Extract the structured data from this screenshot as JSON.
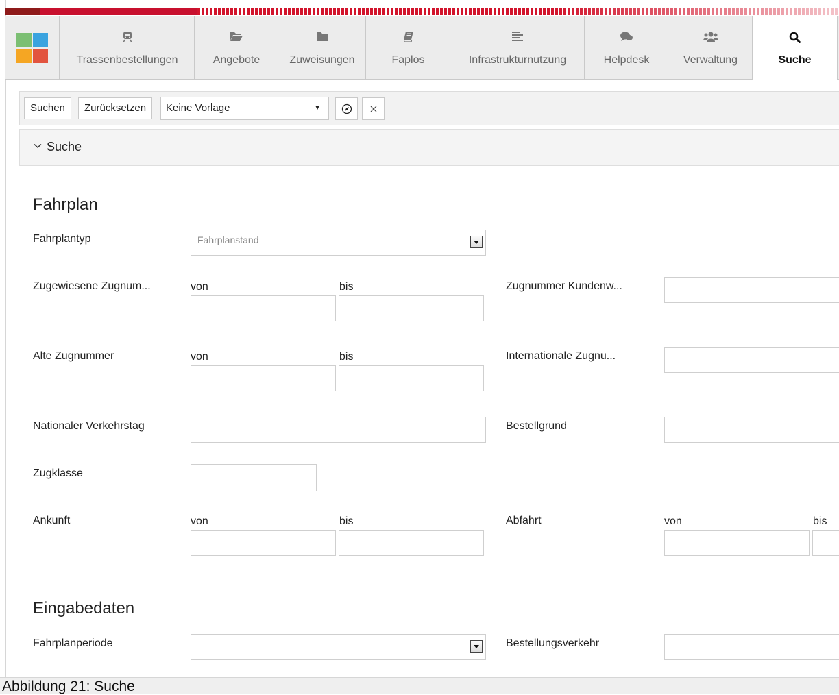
{
  "nav": {
    "tabs": [
      {
        "label": "Trassenbestellungen",
        "icon": "train-icon"
      },
      {
        "label": "Angebote",
        "icon": "folder-open-icon"
      },
      {
        "label": "Zuweisungen",
        "icon": "folder-icon"
      },
      {
        "label": "Faplos",
        "icon": "book-icon"
      },
      {
        "label": "Infrastrukturnutzung",
        "icon": "list-icon"
      },
      {
        "label": "Helpdesk",
        "icon": "chat-icon"
      },
      {
        "label": "Verwaltung",
        "icon": "users-icon"
      },
      {
        "label": "Suche",
        "icon": "search-icon",
        "active": true
      }
    ]
  },
  "toolbar": {
    "search_label": "Suchen",
    "reset_label": "Zurücksetzen",
    "template_value": "Keine Vorlage"
  },
  "section": {
    "title": "Suche"
  },
  "fahrplan": {
    "title": "Fahrplan",
    "fahrplantyp_label": "Fahrplantyp",
    "fahrplantyp_value": "Fahrplanstand",
    "zugewiesene_label": "Zugewiesene Zugnum...",
    "von": "von",
    "bis": "bis",
    "kundenw_label": "Zugnummer Kundenw...",
    "alte_label": "Alte Zugnummer",
    "international_label": "Internationale Zugnu...",
    "verkehrstag_label": "Nationaler Verkehrstag",
    "bestellgrund_label": "Bestellgrund",
    "zugklasse_label": "Zugklasse",
    "ankunft_label": "Ankunft",
    "abfahrt_label": "Abfahrt"
  },
  "eingabe": {
    "title": "Eingabedaten",
    "periode_label": "Fahrplanperiode",
    "verkehr_label": "Bestellungsverkehr"
  },
  "caption": "Abbildung 21: Suche"
}
